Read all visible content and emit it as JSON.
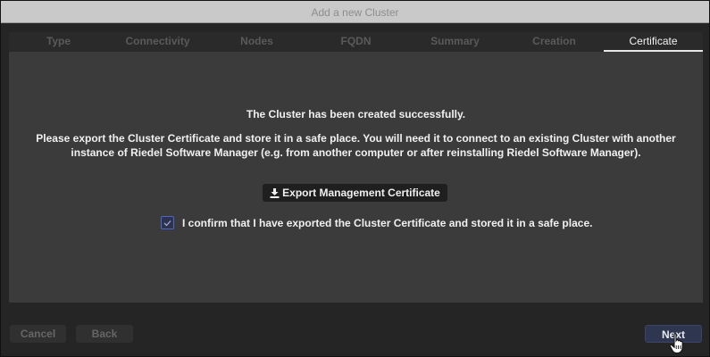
{
  "window": {
    "title": "Add a new Cluster"
  },
  "tabs": [
    {
      "label": "Type",
      "active": false
    },
    {
      "label": "Connectivity",
      "active": false
    },
    {
      "label": "Nodes",
      "active": false
    },
    {
      "label": "FQDN",
      "active": false
    },
    {
      "label": "Summary",
      "active": false
    },
    {
      "label": "Creation",
      "active": false
    },
    {
      "label": "Certificate",
      "active": true
    }
  ],
  "content": {
    "success_message": "The Cluster has been created successfully.",
    "export_message": "Please export the Cluster Certificate and store it in a safe place. You will need it to connect to an existing Cluster with another instance of Riedel Software Manager (e.g. from another computer or after reinstalling Riedel Software Manager).",
    "export_button_label": "Export Management Certificate",
    "export_button_icon": "download-icon",
    "confirm_checkbox_checked": true,
    "confirm_label": "I confirm that I have exported the Cluster Certificate and stored it in a safe place."
  },
  "footer": {
    "cancel_label": "Cancel",
    "back_label": "Back",
    "next_label": "Next"
  },
  "colors": {
    "accent": "#4a67c9",
    "panel_bg": "#3b3b3b",
    "next_button_bg": "#2f3650"
  }
}
